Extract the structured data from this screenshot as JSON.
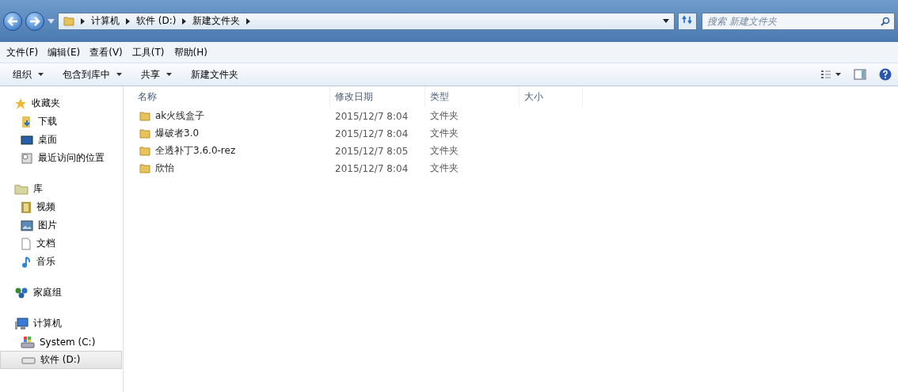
{
  "address_bar": {
    "crumbs": [
      "计算机",
      "软件 (D:)",
      "新建文件夹"
    ]
  },
  "search": {
    "placeholder": "搜索 新建文件夹"
  },
  "menu": [
    "文件(F)",
    "编辑(E)",
    "查看(V)",
    "工具(T)",
    "帮助(H)"
  ],
  "toolbar": [
    {
      "label": "组织",
      "dropdown": true
    },
    {
      "label": "包含到库中",
      "dropdown": true
    },
    {
      "label": "共享",
      "dropdown": true
    },
    {
      "label": "新建文件夹",
      "dropdown": false
    }
  ],
  "sidebar": {
    "groups": [
      {
        "label": "收藏夹",
        "kind": "star",
        "children": [
          {
            "label": "下载",
            "kind": "download",
            "selected": false
          },
          {
            "label": "桌面",
            "kind": "desktop",
            "selected": false
          },
          {
            "label": "最近访问的位置",
            "kind": "recent",
            "selected": false
          }
        ]
      },
      {
        "label": "库",
        "kind": "library",
        "children": [
          {
            "label": "视频",
            "kind": "video",
            "selected": false
          },
          {
            "label": "图片",
            "kind": "picture",
            "selected": false
          },
          {
            "label": "文档",
            "kind": "document",
            "selected": false
          },
          {
            "label": "音乐",
            "kind": "music",
            "selected": false
          }
        ]
      },
      {
        "label": "家庭组",
        "kind": "homegroup"
      },
      {
        "label": "计算机",
        "kind": "computer",
        "children": [
          {
            "label": "System (C:)",
            "kind": "system-drive",
            "selected": false
          },
          {
            "label": "软件 (D:)",
            "kind": "drive",
            "selected": true
          }
        ]
      }
    ]
  },
  "table": {
    "columns": [
      "名称",
      "修改日期",
      "类型",
      "大小"
    ],
    "rows": [
      {
        "name": "ak火线盒子",
        "modified": "2015/12/7 8:04",
        "type": "文件夹"
      },
      {
        "name": "爆破者3.0",
        "modified": "2015/12/7 8:04",
        "type": "文件夹"
      },
      {
        "name": "全透补丁3.6.0-rez",
        "modified": "2015/12/7 8:05",
        "type": "文件夹"
      },
      {
        "name": "欣怡",
        "modified": "2015/12/7 8:04",
        "type": "文件夹"
      }
    ]
  }
}
